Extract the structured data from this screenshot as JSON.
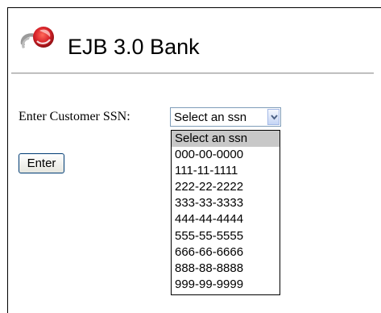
{
  "app": {
    "title": "EJB 3.0 Bank"
  },
  "form": {
    "ssn_label": "Enter Customer SSN:",
    "select": {
      "selected": "Select an ssn",
      "options": [
        "Select an ssn",
        "000-00-0000",
        "111-11-1111",
        "222-22-2222",
        "333-33-3333",
        "444-44-4444",
        "555-55-5555",
        "666-66-6666",
        "888-88-8888",
        "999-99-9999"
      ],
      "highlighted_index": 0
    },
    "enter_label": "Enter"
  },
  "colors": {
    "logo_red": "#d8232a",
    "logo_gray": "#8a8a8a",
    "option_highlight": "#c8c8c8"
  },
  "icons": {
    "logo": "bank-logo-icon",
    "dropdown": "chevron-down-icon"
  }
}
